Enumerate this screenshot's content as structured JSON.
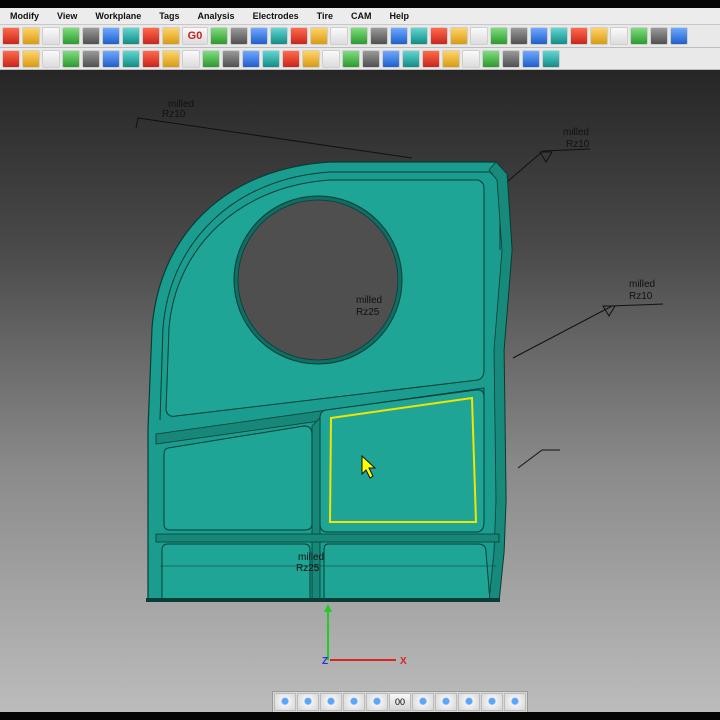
{
  "menu": [
    "Modify",
    "View",
    "Workplane",
    "Tags",
    "Analysis",
    "Electrodes",
    "Tire",
    "CAM",
    "Help"
  ],
  "toolbar_row1": [
    {
      "name": "workplane-icon"
    },
    {
      "name": "zoom-icon"
    },
    {
      "name": "dimension-icon"
    },
    {
      "name": "move-icon"
    },
    {
      "name": "rotate-icon"
    },
    {
      "name": "mirror-icon"
    },
    {
      "name": "tag-icon"
    },
    {
      "name": "wire-icon"
    },
    {
      "name": "measure-icon"
    },
    {
      "name": "g0-icon",
      "text": "G0"
    },
    {
      "name": "snap-icon"
    },
    {
      "name": "link-icon"
    },
    {
      "name": "green-part-icon"
    },
    {
      "name": "step-icon"
    },
    {
      "name": "blend-icon"
    },
    {
      "name": "curve-icon"
    },
    {
      "name": "hole-icon"
    },
    {
      "name": "pocket-icon"
    },
    {
      "name": "tag-v-icon"
    },
    {
      "name": "tag-v2-icon"
    },
    {
      "name": "wire-v-icon"
    },
    {
      "name": "link-v-icon"
    },
    {
      "name": "surface-icon"
    },
    {
      "name": "project-icon"
    },
    {
      "name": "divide-icon"
    },
    {
      "name": "fillet-icon"
    },
    {
      "name": "chamfer-icon"
    },
    {
      "name": "mesh-icon"
    },
    {
      "name": "grid-icon"
    },
    {
      "name": "corner-icon"
    },
    {
      "name": "corner-two-icon"
    },
    {
      "name": "hatch-icon"
    },
    {
      "name": "clip-icon"
    },
    {
      "name": "search-icon"
    }
  ],
  "toolbar_row2": [
    {
      "name": "new-file-icon"
    },
    {
      "name": "open-file-icon"
    },
    {
      "name": "save-file-icon"
    },
    {
      "name": "print-icon"
    },
    {
      "name": "gear-icon"
    },
    {
      "name": "info-icon"
    },
    {
      "name": "italic-i-icon"
    },
    {
      "name": "undo-icon"
    },
    {
      "name": "redo-icon"
    },
    {
      "name": "relate-icon"
    },
    {
      "name": "cube-icon"
    },
    {
      "name": "sphere-icon"
    },
    {
      "name": "torus-icon"
    },
    {
      "name": "circle-p-icon"
    },
    {
      "name": "wireframe-icon"
    },
    {
      "name": "shade-icon"
    },
    {
      "name": "hatch-color-icon"
    },
    {
      "name": "split-icon"
    },
    {
      "name": "offset-icon"
    },
    {
      "name": "trim-icon"
    },
    {
      "name": "extend-icon"
    },
    {
      "name": "fix-icon"
    },
    {
      "name": "heal-icon"
    },
    {
      "name": "analyze-icon"
    },
    {
      "name": "diamond-icon"
    },
    {
      "name": "color-icon"
    },
    {
      "name": "play-icon"
    },
    {
      "name": "grid-two-icon"
    }
  ],
  "annotations": [
    {
      "id": "top-left",
      "line1": "milled",
      "line2": "Rz10"
    },
    {
      "id": "top-right",
      "line1": "milled",
      "line2": "Rz10"
    },
    {
      "id": "right",
      "line1": "milled",
      "line2": "Rz10"
    },
    {
      "id": "center",
      "line1": "milled",
      "line2": "Rz25"
    },
    {
      "id": "bottom",
      "line1": "milled",
      "line2": "Rz25"
    }
  ],
  "axis": {
    "x_label": "X",
    "z_label": "Z"
  },
  "bottom_toolbar": [
    {
      "name": "select-icon"
    },
    {
      "name": "globe-icon"
    },
    {
      "name": "pick-icon"
    },
    {
      "name": "pencil-icon"
    },
    {
      "name": "tool-icon"
    },
    {
      "name": "counter-icon",
      "text": "00"
    },
    {
      "name": "probe-icon"
    },
    {
      "name": "cutter-icon"
    },
    {
      "name": "magic-icon"
    },
    {
      "name": "pen-icon"
    },
    {
      "name": "settings-wheel-icon"
    }
  ],
  "colors": {
    "part": "#1a9d8e",
    "edge": "#0a3d35",
    "highlight": "#f2e400",
    "cursor": "#ffff00"
  }
}
